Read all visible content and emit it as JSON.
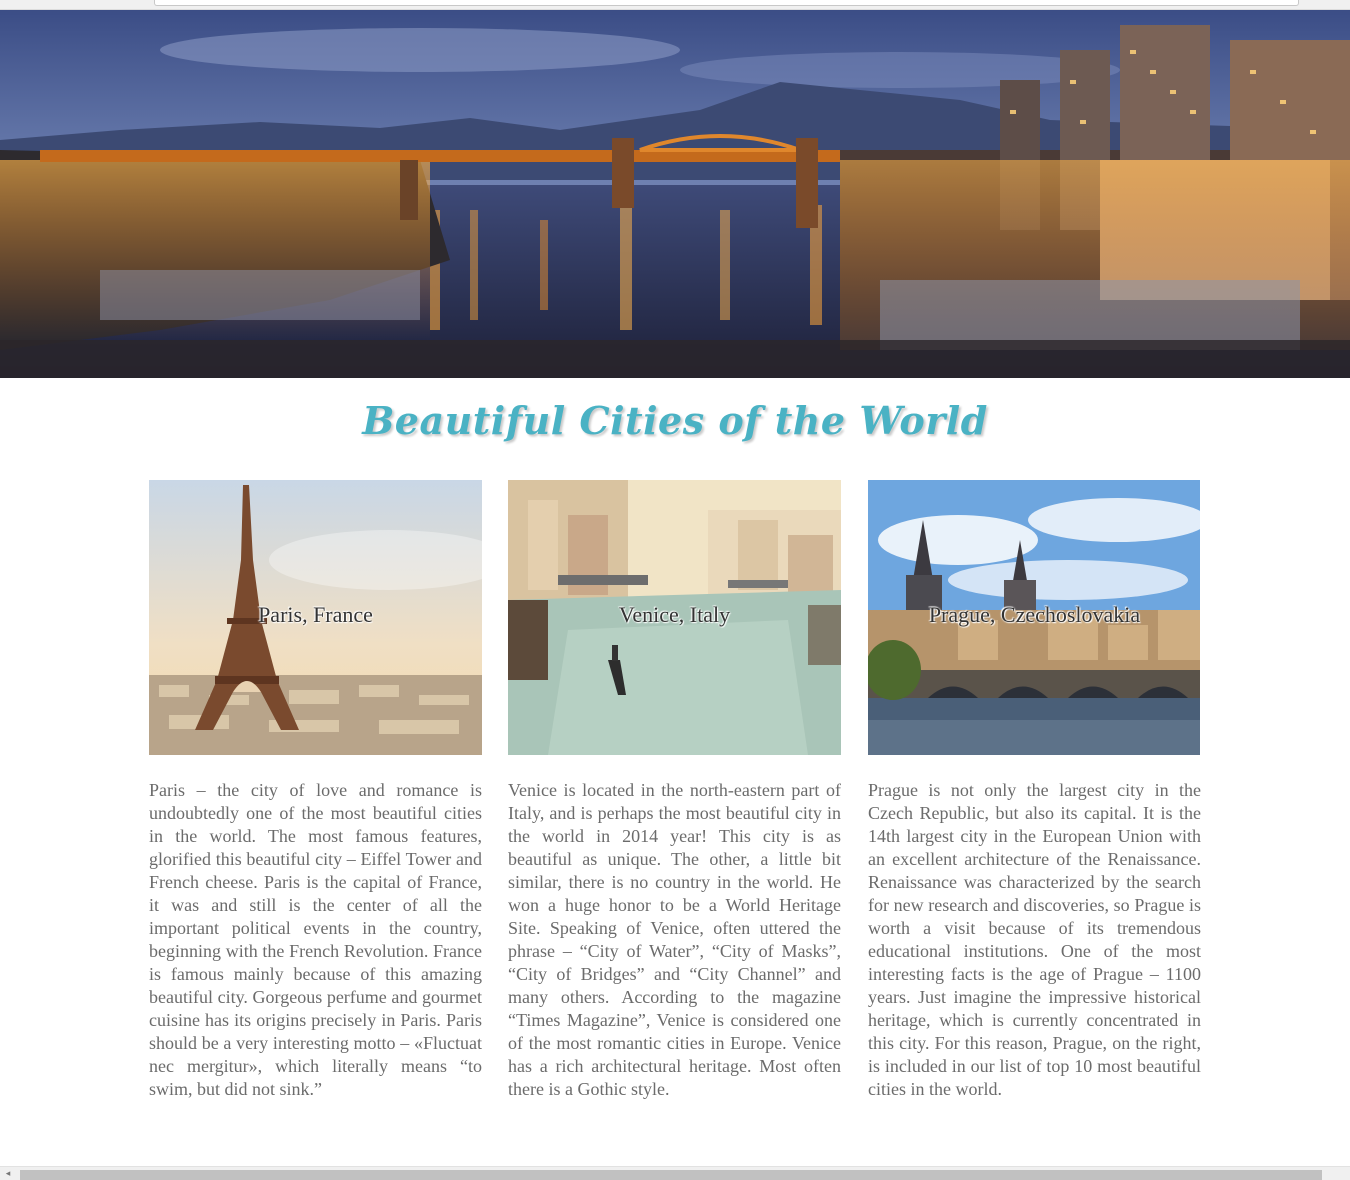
{
  "page": {
    "title": "Beautiful Cities of the World"
  },
  "cities": [
    {
      "caption": "Paris, France",
      "text": "Paris – the city of love and romance is undoubtedly one of the most beautiful cities in the world. The most famous features, glorified this beautiful city – Eiffel Tower and French cheese. Paris is the capital of France, it was and still is the center of all the important political events in the country, beginning with the French Revolution. France is famous mainly because of this amazing beautiful city. Gorgeous perfume and gourmet cuisine has its origins precisely in Paris. Paris should be a very interesting motto – «Fluctuat nec mergitur», which literally means “to swim, but did not sink.”"
    },
    {
      "caption": "Venice, Italy",
      "text": "Venice is located in the north-eastern part of Italy, and is perhaps the most beautiful city in the world in 2014 year! This city is as beautiful as unique. The other, a little bit similar, there is no country in the world. He won a huge honor to be a World Heritage Site. Speaking of Venice, often uttered the phrase – “City of Water”, “City of Masks”, “City of Bridges” and “City Channel” and many others. According to the magazine “Times Magazine”, Venice is considered one of the most romantic cities in Europe. Venice has a rich architectural heritage. Most often there is a Gothic style."
    },
    {
      "caption": "Prague, Czechoslovakia",
      "text": "Prague is not only the largest city in the Czech Republic, but also its capital. It is the 14th largest city in the European Union with an excellent architecture of the Renaissance. Renaissance was characterized by the search for new research and discoveries, so Prague is worth a visit because of its tremendous educational institutions. One of the most interesting facts is the age of Prague – 1100 years. Just imagine the impressive historical heritage, which is currently concentrated in this city. For this reason, Prague, on the right, is included in our list of top 10 most beautiful cities in the world."
    }
  ],
  "colors": {
    "title": "#4ab2c4",
    "body_text": "#6b6b6b"
  },
  "icons": {
    "scroll_left": "left-arrow-icon"
  }
}
